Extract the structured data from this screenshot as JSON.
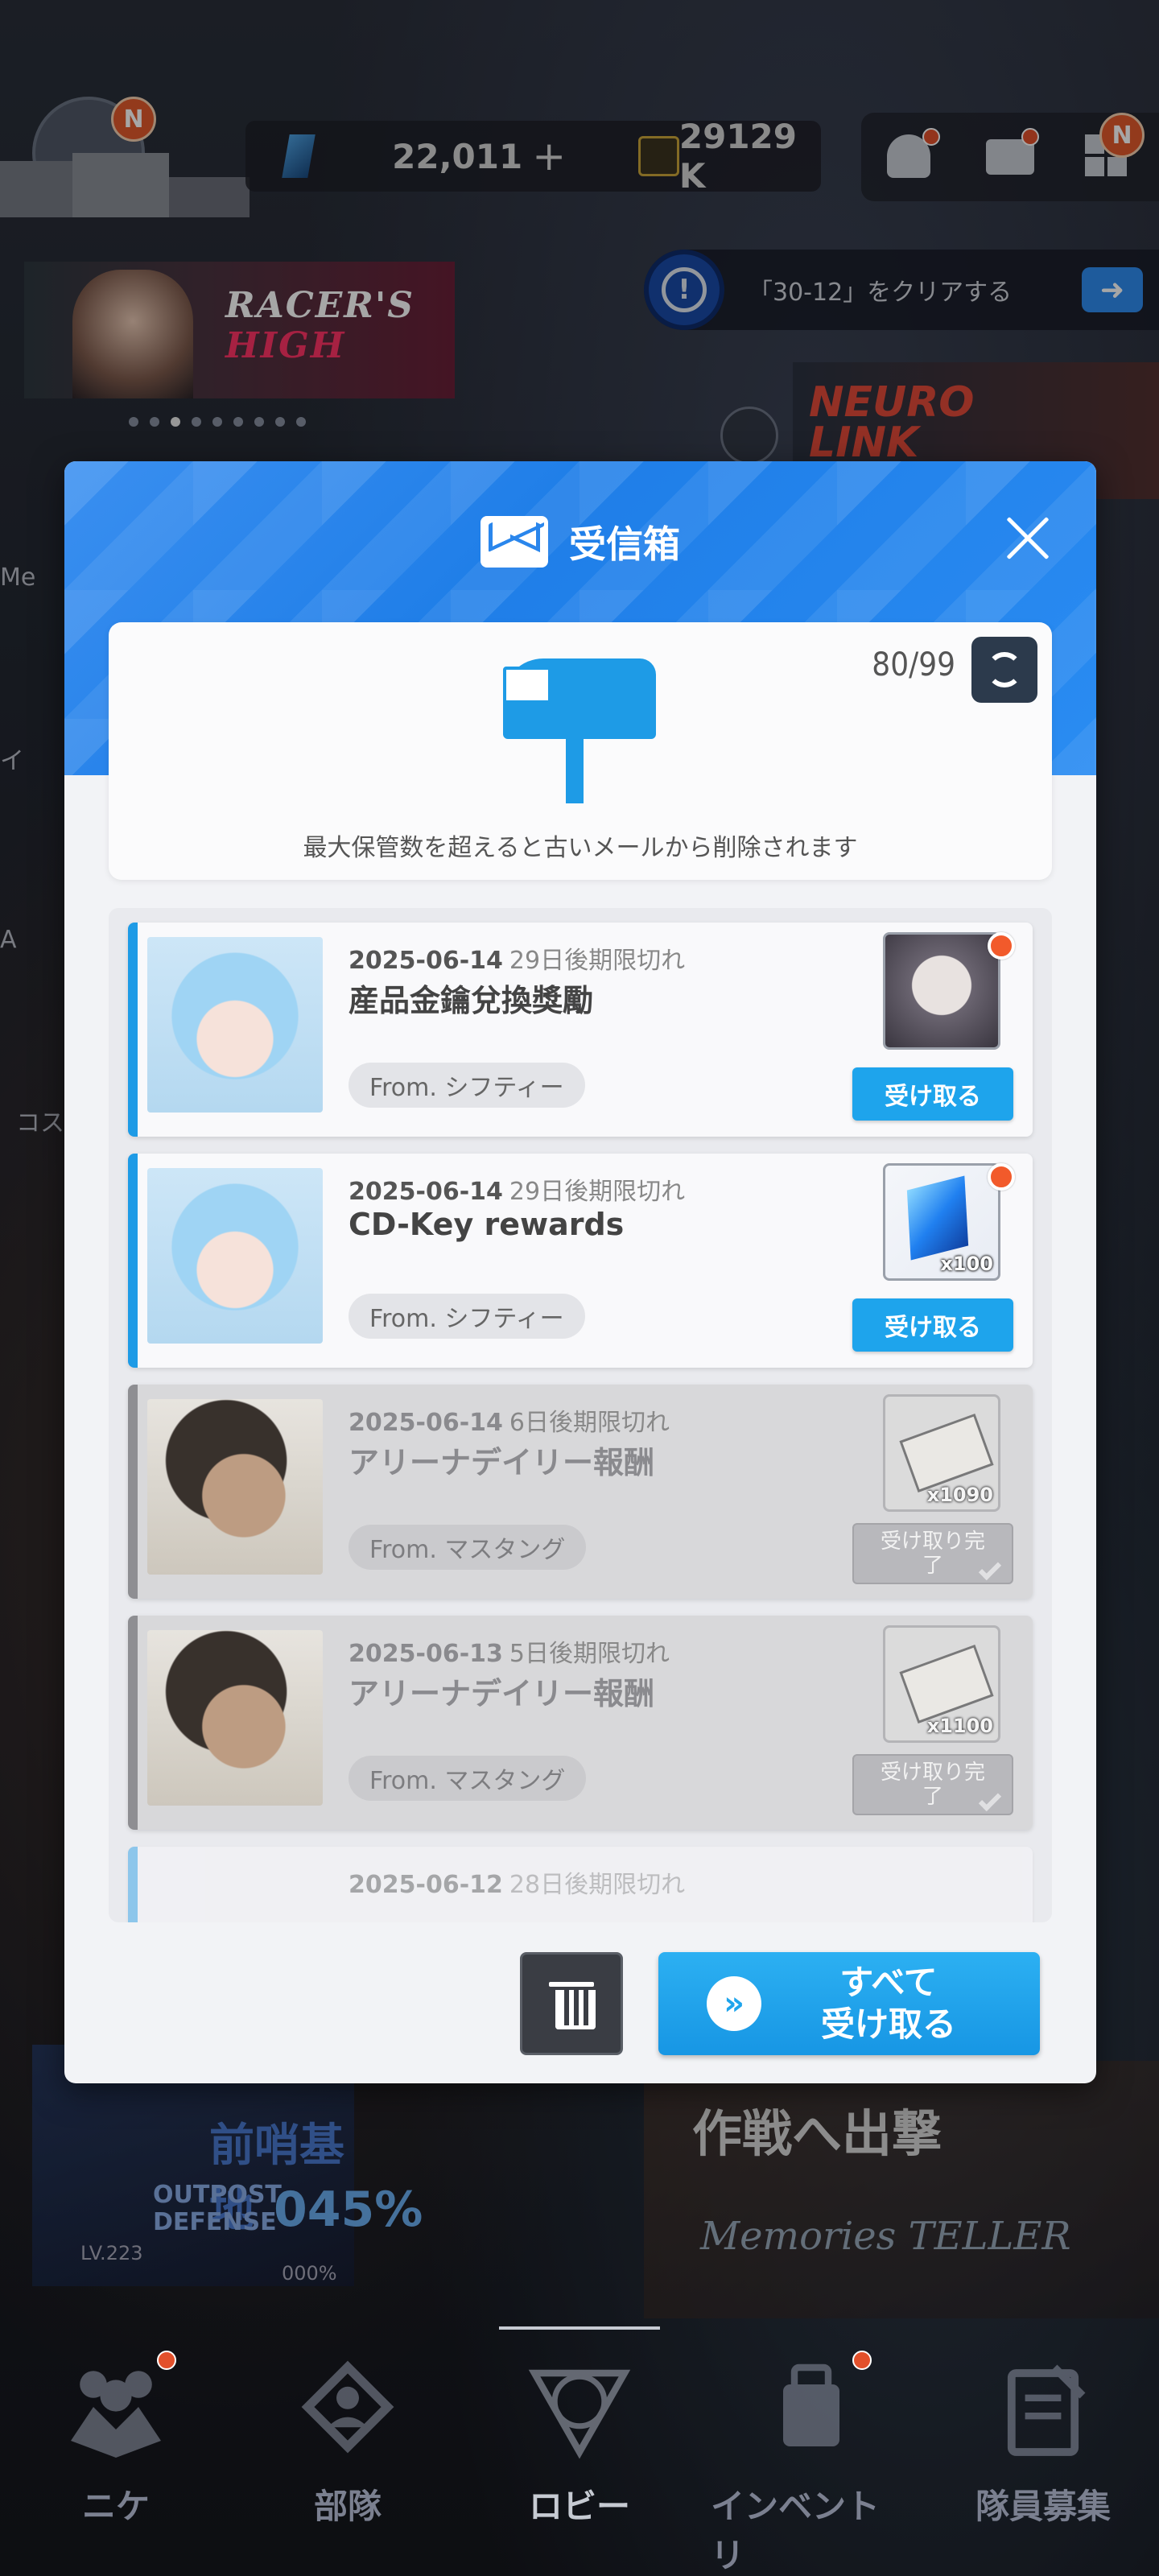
{
  "topbar": {
    "gems": "22,011",
    "gems_plus": "+",
    "credits": "29129 K",
    "badge_n": "N"
  },
  "lobby": {
    "banner_title_a": "RACER'S",
    "banner_title_b": "HIGH",
    "quest_text": "「30-12」をクリアする",
    "neuro_title_a": "NEURO",
    "neuro_title_b": "LINK",
    "side_label_1": "Me",
    "side_label_2": "イ",
    "side_label_3": "A",
    "side_label_4": "コス",
    "outpost_title": "前哨基地",
    "outpost_sub_a": "OUTPOST",
    "outpost_sub_b": "DEFENSE",
    "outpost_pct": "045%",
    "outpost_lv": "LV.223",
    "outpost_pct2": "000%",
    "battle_title": "作戦へ出撃",
    "battle_sub": "Memories TELLER"
  },
  "nav": {
    "items": [
      {
        "label": "ニケ",
        "badge": true
      },
      {
        "label": "部隊",
        "badge": false
      },
      {
        "label": "ロビー",
        "badge": false
      },
      {
        "label": "インベントリ",
        "badge": true
      },
      {
        "label": "隊員募集",
        "badge": false
      }
    ]
  },
  "modal": {
    "title": "受信箱",
    "count": "80/99",
    "info": "最大保管数を超えると古いメールから削除されます",
    "claim_all": "すべて\n受け取る",
    "claim_all_line1": "すべて",
    "claim_all_line2": "受け取る",
    "claim_label": "受け取る",
    "claimed_label": "受け取り完了",
    "mails": [
      {
        "date": "2025-06-14",
        "expiry": "29日後期限切れ",
        "title": "産品金鑰兌換獎勵",
        "from": "From. シフティー",
        "qty": "",
        "status": "unclaimed"
      },
      {
        "date": "2025-06-14",
        "expiry": "29日後期限切れ",
        "title": "CD-Key rewards",
        "from": "From. シフティー",
        "qty": "x100",
        "status": "unclaimed"
      },
      {
        "date": "2025-06-14",
        "expiry": "6日後期限切れ",
        "title": "アリーナデイリー報酬",
        "from": "From. マスタング",
        "qty": "x1090",
        "status": "claimed"
      },
      {
        "date": "2025-06-13",
        "expiry": "5日後期限切れ",
        "title": "アリーナデイリー報酬",
        "from": "From. マスタング",
        "qty": "x1100",
        "status": "claimed"
      },
      {
        "date": "2025-06-12",
        "expiry": "28日後期限切れ"
      }
    ]
  },
  "colors": {
    "accent": "#1ea4ec",
    "header_blue": "#2a86ec",
    "badge_red": "#f25a2b"
  }
}
